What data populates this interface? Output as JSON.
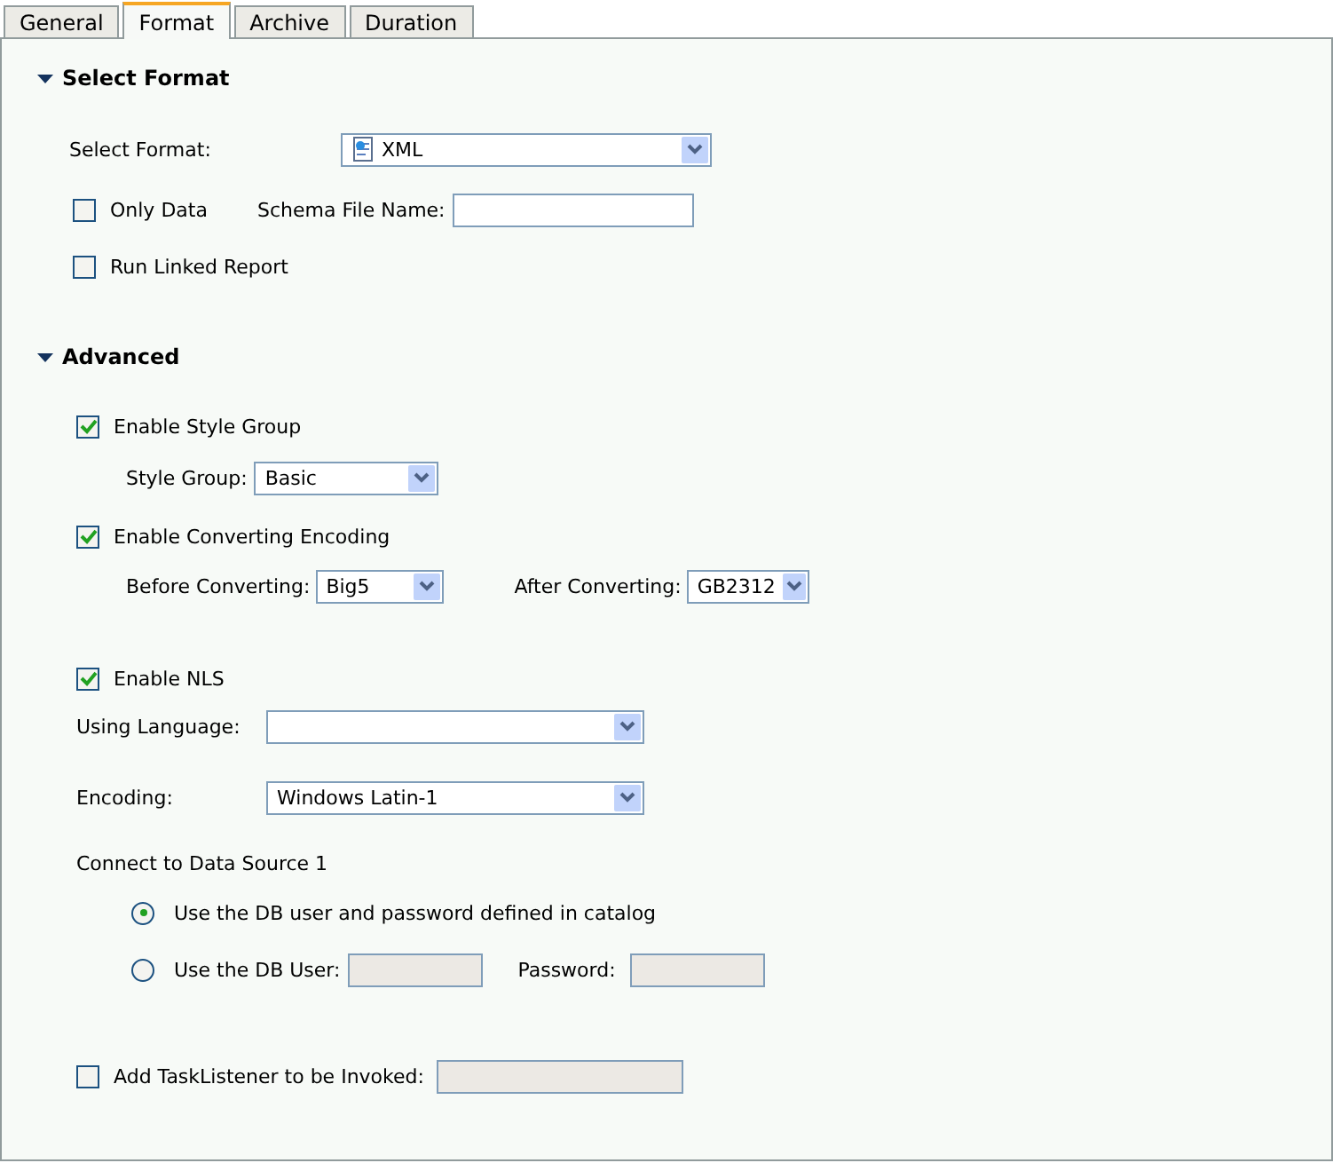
{
  "tabs": [
    {
      "label": "General",
      "selected": false
    },
    {
      "label": "Format",
      "selected": true
    },
    {
      "label": "Archive",
      "selected": false
    },
    {
      "label": "Duration",
      "selected": false
    }
  ],
  "select_format": {
    "title": "Select Format",
    "expanded": true,
    "format": {
      "label": "Select Format:",
      "value": "XML"
    },
    "only_data": {
      "label": "Only Data",
      "checked": false
    },
    "schema_file": {
      "label": "Schema File Name:",
      "disabled": false
    },
    "run_linked_report": {
      "label": "Run Linked Report",
      "checked": false
    }
  },
  "advanced": {
    "title": "Advanced",
    "expanded": true,
    "enable_style_group": {
      "label": "Enable Style Group",
      "checked": true
    },
    "style_group": {
      "label": "Style Group:",
      "value": "Basic"
    },
    "enable_converting": {
      "label": "Enable Converting Encoding",
      "checked": true
    },
    "before_converting": {
      "label": "Before Converting:",
      "value": "Big5"
    },
    "after_converting": {
      "label": "After Converting:",
      "value": "GB2312"
    },
    "enable_nls": {
      "label": "Enable NLS",
      "checked": true
    },
    "using_language": {
      "label": "Using Language:"
    },
    "encoding": {
      "label": "Encoding:",
      "value": "Windows Latin-1"
    },
    "connect": {
      "title": "Connect to Data Source 1",
      "options": [
        {
          "label": "Use the DB user and password defined in catalog",
          "selected": true
        },
        {
          "label": "Use the DB User:",
          "selected": false
        }
      ],
      "db_user": {
        "disabled": true
      },
      "password": {
        "label": "Password:",
        "disabled": true
      }
    },
    "task_listener": {
      "label": "Add TaskListener to be Invoked:",
      "checked": false,
      "field_disabled": true
    }
  }
}
